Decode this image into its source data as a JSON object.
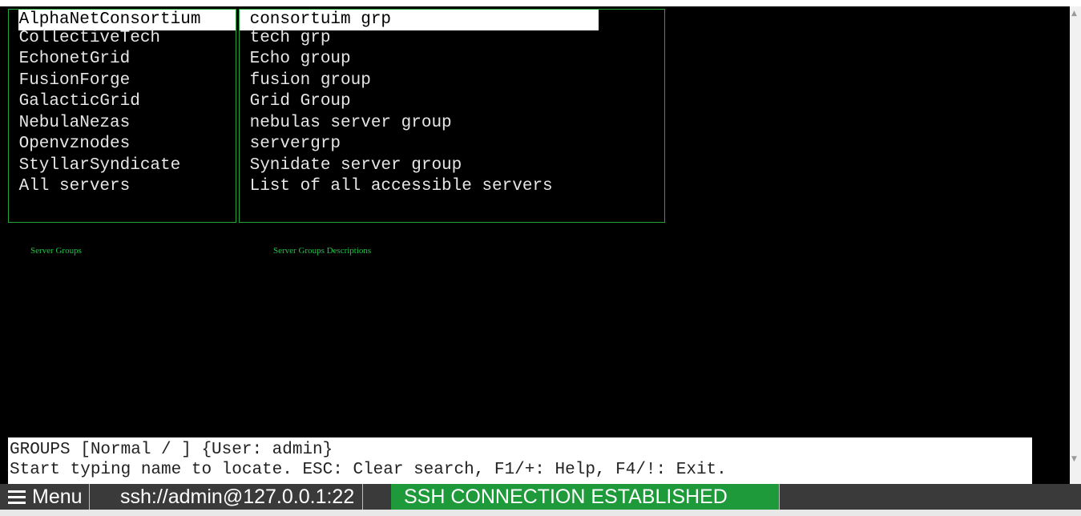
{
  "groups_pane": {
    "items": [
      {
        "label": "*AlphaNetConsortium",
        "selected": true
      },
      {
        "label": " CollectiveTech"
      },
      {
        "label": " EchonetGrid"
      },
      {
        "label": " FusionForge"
      },
      {
        "label": " GalacticGrid"
      },
      {
        "label": " NebulaNezas"
      },
      {
        "label": " Openvznodes"
      },
      {
        "label": " StyllarSyndicate"
      },
      {
        "label": " All servers"
      }
    ],
    "caption": "Server Groups"
  },
  "desc_pane": {
    "items": [
      {
        "label": " consortuim grp",
        "selected": true
      },
      {
        "label": " tech grp"
      },
      {
        "label": " Echo group"
      },
      {
        "label": " fusion group"
      },
      {
        "label": " Grid Group"
      },
      {
        "label": " nebulas server group"
      },
      {
        "label": " servergrp"
      },
      {
        "label": " Synidate server group"
      },
      {
        "label": " List of all accessible servers"
      }
    ],
    "caption": "Server Groups Descriptions"
  },
  "status": {
    "line1": "GROUPS [Normal / ] {User: admin}",
    "line2": "Start typing name to locate. ESC: Clear search, F1/+: Help, F4/!: Exit."
  },
  "toolbar": {
    "menu_label": "Menu",
    "ssh_url": "ssh://admin@127.0.0.1:22",
    "connection_status": "SSH CONNECTION ESTABLISHED"
  },
  "colors": {
    "border": "#22a63a",
    "caption": "#22c34a",
    "badge": "#1f9a3a"
  }
}
